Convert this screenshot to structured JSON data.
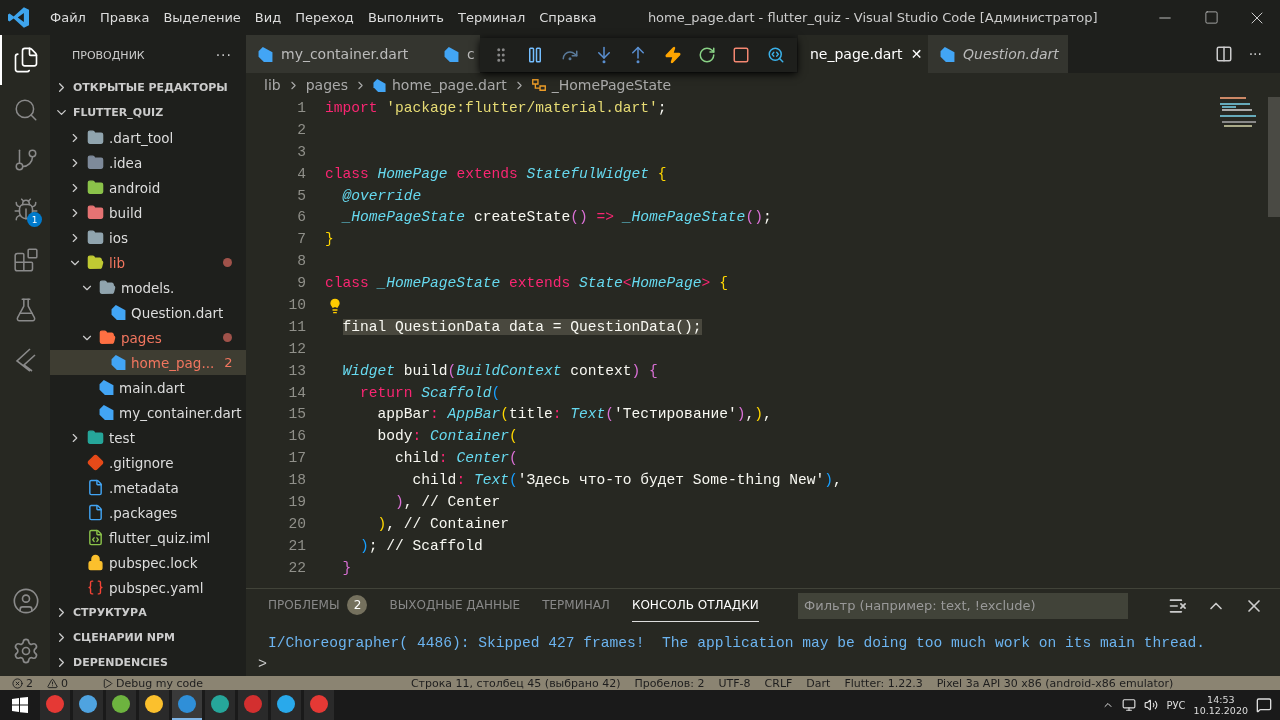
{
  "titlebar": {
    "menu": [
      "Файл",
      "Правка",
      "Выделение",
      "Вид",
      "Переход",
      "Выполнить",
      "Терминал",
      "Справка"
    ],
    "title": "home_page.dart - flutter_quiz - Visual Studio Code [Администратор]"
  },
  "activity_bar": [
    {
      "kind": "files",
      "selected": true
    },
    {
      "kind": "search",
      "selected": false
    },
    {
      "kind": "git",
      "selected": false
    },
    {
      "kind": "debug",
      "selected": false,
      "badge": "1"
    },
    {
      "kind": "extensions",
      "selected": false
    },
    {
      "kind": "flask",
      "selected": false
    },
    {
      "kind": "flutter",
      "selected": false
    }
  ],
  "activity_bottom": [
    {
      "kind": "account"
    },
    {
      "kind": "settings"
    }
  ],
  "sidebar": {
    "title": "ПРОВОДНИК",
    "more": "···",
    "sections_top": [
      {
        "label": "ОТКРЫТЫЕ РЕДАКТОРЫ",
        "expanded": false
      },
      {
        "label": "FLUTTER_QUIZ",
        "expanded": true
      }
    ],
    "tree": [
      {
        "label": ".dart_tool",
        "kind": "folder",
        "color": "#90a4ae",
        "expanded": false,
        "selected": false,
        "error": false,
        "dot": false
      },
      {
        "label": ".idea",
        "kind": "folder",
        "color": "#7e8a9a",
        "expanded": false,
        "selected": false,
        "error": false,
        "dot": false
      },
      {
        "label": "android",
        "kind": "folder",
        "color": "#8bc34a",
        "expanded": false,
        "selected": false,
        "error": false,
        "dot": false
      },
      {
        "label": "build",
        "kind": "folder",
        "color": "#e57373",
        "expanded": false,
        "selected": false,
        "error": false,
        "dot": false
      },
      {
        "label": "ios",
        "kind": "folder",
        "color": "#90a4ae",
        "expanded": false,
        "selected": false,
        "error": false,
        "dot": false
      },
      {
        "label": "lib",
        "kind": "folder",
        "color": "#c0ca33",
        "expanded": true,
        "selected": false,
        "error": true,
        "dot": true,
        "children": [
          {
            "label": "models.",
            "kind": "folder",
            "color": "#90a4ae",
            "expanded": true,
            "selected": false,
            "error": false,
            "dot": false,
            "children": [
              {
                "label": "Question.dart",
                "kind": "dart",
                "color": "#42a5f5",
                "selected": false,
                "error": false,
                "dot": false
              }
            ]
          },
          {
            "label": "pages",
            "kind": "folder",
            "color": "#ff7043",
            "expanded": true,
            "selected": false,
            "error": true,
            "dot": true,
            "children": [
              {
                "label": "home_pag...",
                "kind": "dart",
                "color": "#42a5f5",
                "selected": true,
                "error": true,
                "dot": false,
                "badge": "2"
              }
            ]
          },
          {
            "label": "main.dart",
            "kind": "dart",
            "color": "#42a5f5",
            "selected": false,
            "error": false,
            "dot": false
          },
          {
            "label": "my_container.dart",
            "kind": "dart",
            "color": "#42a5f5",
            "selected": false,
            "error": false,
            "dot": false
          }
        ]
      },
      {
        "label": "test",
        "kind": "folder",
        "color": "#26a69a",
        "expanded": false,
        "selected": false,
        "error": false,
        "dot": false
      },
      {
        "label": ".gitignore",
        "kind": "git",
        "color": "#e64a19",
        "selected": false,
        "error": false,
        "dot": false
      },
      {
        "label": ".metadata",
        "kind": "doc",
        "color": "#42a5f5",
        "selected": false,
        "error": false,
        "dot": false
      },
      {
        "label": ".packages",
        "kind": "doc",
        "color": "#42a5f5",
        "selected": false,
        "error": false,
        "dot": false
      },
      {
        "label": "flutter_quiz.iml",
        "kind": "xml",
        "color": "#8bc34a",
        "selected": false,
        "error": false,
        "dot": false
      },
      {
        "label": "pubspec.lock",
        "kind": "lock",
        "color": "#fbc02d",
        "selected": false,
        "error": false,
        "dot": false
      },
      {
        "label": "pubspec.yaml",
        "kind": "yaml",
        "color": "#f44336",
        "selected": false,
        "error": false,
        "dot": false
      }
    ],
    "sections_bottom": [
      {
        "label": "СТРУКТУРА",
        "expanded": false
      },
      {
        "label": "СЦЕНАРИИ NPM",
        "expanded": false
      },
      {
        "label": "DEPENDENCIES",
        "expanded": false
      }
    ]
  },
  "tabs": [
    {
      "label": "my_container.dart",
      "selected": false,
      "italic": false
    },
    {
      "label": "c",
      "selected": false,
      "italic": false
    },
    {
      "label": "ne_page.dart",
      "selected": true,
      "italic": false,
      "close": "✕"
    },
    {
      "label": "Question.dart",
      "selected": false,
      "italic": true
    }
  ],
  "debug_toolbar": [
    {
      "kind": "grip"
    },
    {
      "kind": "pause"
    },
    {
      "kind": "step-over"
    },
    {
      "kind": "step-into"
    },
    {
      "kind": "step-out"
    },
    {
      "kind": "hot-reload"
    },
    {
      "kind": "restart"
    },
    {
      "kind": "stop"
    },
    {
      "kind": "inspect"
    }
  ],
  "breadcrumbs": [
    "lib",
    "pages",
    "home_page.dart",
    "_HomePageState"
  ],
  "code": [
    {
      "n": "1",
      "tokens": [
        {
          "t": "import",
          "kind": "keyword"
        },
        {
          "t": " 'package:flutter/material.dart'",
          "kind": "string"
        },
        {
          "t": ";",
          "kind": "plain"
        }
      ]
    },
    {
      "n": "2"
    },
    {
      "n": "3"
    },
    {
      "n": "4",
      "tokens": [
        {
          "t": "class",
          "kind": "keyword"
        },
        {
          "t": " HomePage",
          "kind": "type"
        },
        {
          "t": " extends",
          "kind": "keyword"
        },
        {
          "t": " StatefulWidget",
          "kind": "type"
        },
        {
          "t": " {",
          "kind": "bracket1"
        }
      ]
    },
    {
      "n": "5",
      "tokens": [
        {
          "t": "  @override",
          "kind": "type"
        }
      ]
    },
    {
      "n": "6",
      "tokens": [
        {
          "t": "  _HomePageState",
          "kind": "type"
        },
        {
          "t": " createState",
          "kind": "plain"
        },
        {
          "t": "()",
          "kind": "bracket2"
        },
        {
          "t": " =>",
          "kind": "keyword"
        },
        {
          "t": " _HomePageState",
          "kind": "type"
        },
        {
          "t": "()",
          "kind": "bracket2"
        },
        {
          "t": ";",
          "kind": "plain"
        }
      ]
    },
    {
      "n": "7",
      "tokens": [
        {
          "t": "}",
          "kind": "bracket1"
        }
      ]
    },
    {
      "n": "8"
    },
    {
      "n": "9",
      "tokens": [
        {
          "t": "class",
          "kind": "keyword"
        },
        {
          "t": " _HomePageState",
          "kind": "type"
        },
        {
          "t": " extends",
          "kind": "keyword"
        },
        {
          "t": " State",
          "kind": "type"
        },
        {
          "t": "<",
          "kind": "keyword"
        },
        {
          "t": "HomePage",
          "kind": "type"
        },
        {
          "t": ">",
          "kind": "keyword"
        },
        {
          "t": " {",
          "kind": "bracket1"
        }
      ]
    },
    {
      "n": "10",
      "lightbulb": true
    },
    {
      "n": "11",
      "tokens": [
        {
          "t": "  final QuestionData data = QuestionData();",
          "kind": "selected"
        }
      ]
    },
    {
      "n": "12"
    },
    {
      "n": "13",
      "tokens": [
        {
          "t": "  Widget",
          "kind": "type"
        },
        {
          "t": " build",
          "kind": "plain"
        },
        {
          "t": "(",
          "kind": "bracket2"
        },
        {
          "t": "BuildContext",
          "kind": "type"
        },
        {
          "t": " context",
          "kind": "plain"
        },
        {
          "t": ")",
          "kind": "bracket2"
        },
        {
          "t": " {",
          "kind": "bracket2"
        }
      ]
    },
    {
      "n": "14",
      "tokens": [
        {
          "t": "    return",
          "kind": "keyword"
        },
        {
          "t": " Scaffold",
          "kind": "type"
        },
        {
          "t": "(",
          "kind": "bracket3"
        }
      ]
    },
    {
      "n": "15",
      "tokens": [
        {
          "t": "      appBar",
          "kind": "plain"
        },
        {
          "t": ":",
          "kind": "keyword"
        },
        {
          "t": " AppBar",
          "kind": "type"
        },
        {
          "t": "(",
          "kind": "bracket1"
        },
        {
          "t": "title",
          "kind": "plain"
        },
        {
          "t": ":",
          "kind": "keyword"
        },
        {
          "t": " Text",
          "kind": "type"
        },
        {
          "t": "(",
          "kind": "bracket2"
        },
        {
          "t": "'Тестирование'",
          "kind": "plain"
        },
        {
          "t": ")",
          "kind": "bracket2"
        },
        {
          "t": ",",
          "kind": "plain"
        },
        {
          "t": ")",
          "kind": "bracket1"
        },
        {
          "t": ",",
          "kind": "plain"
        }
      ]
    },
    {
      "n": "16",
      "tokens": [
        {
          "t": "      body",
          "kind": "plain"
        },
        {
          "t": ":",
          "kind": "keyword"
        },
        {
          "t": " Container",
          "kind": "type"
        },
        {
          "t": "(",
          "kind": "bracket1"
        }
      ]
    },
    {
      "n": "17",
      "tokens": [
        {
          "t": "        child",
          "kind": "plain"
        },
        {
          "t": ":",
          "kind": "keyword"
        },
        {
          "t": " Center",
          "kind": "type"
        },
        {
          "t": "(",
          "kind": "bracket2"
        }
      ]
    },
    {
      "n": "18",
      "tokens": [
        {
          "t": "          child",
          "kind": "plain"
        },
        {
          "t": ":",
          "kind": "keyword"
        },
        {
          "t": " Text",
          "kind": "type"
        },
        {
          "t": "(",
          "kind": "bracket3"
        },
        {
          "t": "'Здесь что-то будет Some-thing New'",
          "kind": "plain"
        },
        {
          "t": ")",
          "kind": "bracket3"
        },
        {
          "t": ",",
          "kind": "plain"
        }
      ]
    },
    {
      "n": "19",
      "tokens": [
        {
          "t": "        )",
          "kind": "bracket2"
        },
        {
          "t": ", // Center",
          "kind": "plain"
        }
      ]
    },
    {
      "n": "20",
      "tokens": [
        {
          "t": "      )",
          "kind": "bracket1"
        },
        {
          "t": ", // Container",
          "kind": "plain"
        }
      ]
    },
    {
      "n": "21",
      "tokens": [
        {
          "t": "    )",
          "kind": "bracket3"
        },
        {
          "t": "; // Scaffold",
          "kind": "plain"
        }
      ]
    },
    {
      "n": "22",
      "tokens": [
        {
          "t": "  }",
          "kind": "bracket2"
        }
      ]
    }
  ],
  "panel": {
    "tabs": [
      {
        "label": "ПРОБЛЕМЫ",
        "selected": false,
        "badge": "2"
      },
      {
        "label": "ВЫХОДНЫЕ ДАННЫЕ",
        "selected": false
      },
      {
        "label": "ТЕРМИНАЛ",
        "selected": false
      },
      {
        "label": "КОНСОЛЬ ОТЛАДКИ",
        "selected": true
      }
    ],
    "filter": {
      "placeholder": "Фильтр (например: text, !exclude)"
    },
    "output": [
      "I/Choreographer( 4486): Skipped 427 frames!  The application may be doing too much work on its main thread."
    ],
    "prompt": ">"
  },
  "status_bar": {
    "errors": "2",
    "warnings": "0",
    "debug": "Debug my code",
    "right": [
      "Строка 11, столбец 45 (выбрано 42)",
      "Пробелов: 2",
      "UTF-8",
      "CRLF",
      "Dart",
      "Flutter: 1.22.3",
      "Pixel 3a API 30 x86 (android-x86 emulator)"
    ]
  },
  "taskbar": {
    "apps": [
      {
        "color": "#e53935",
        "selected": false
      },
      {
        "color": "#4fa3e0",
        "selected": false
      },
      {
        "color": "#6db33f",
        "selected": false
      },
      {
        "color": "#fbc02d",
        "selected": false
      },
      {
        "color": "#2f8fd8",
        "selected": true
      },
      {
        "color": "#26a69a",
        "selected": false
      },
      {
        "color": "#d32f2f",
        "selected": false
      },
      {
        "color": "#29a9eb",
        "selected": false
      },
      {
        "color": "#e53935",
        "selected": false
      }
    ],
    "lang": "РУС",
    "time": "14:53",
    "date": "10.12.2020"
  }
}
